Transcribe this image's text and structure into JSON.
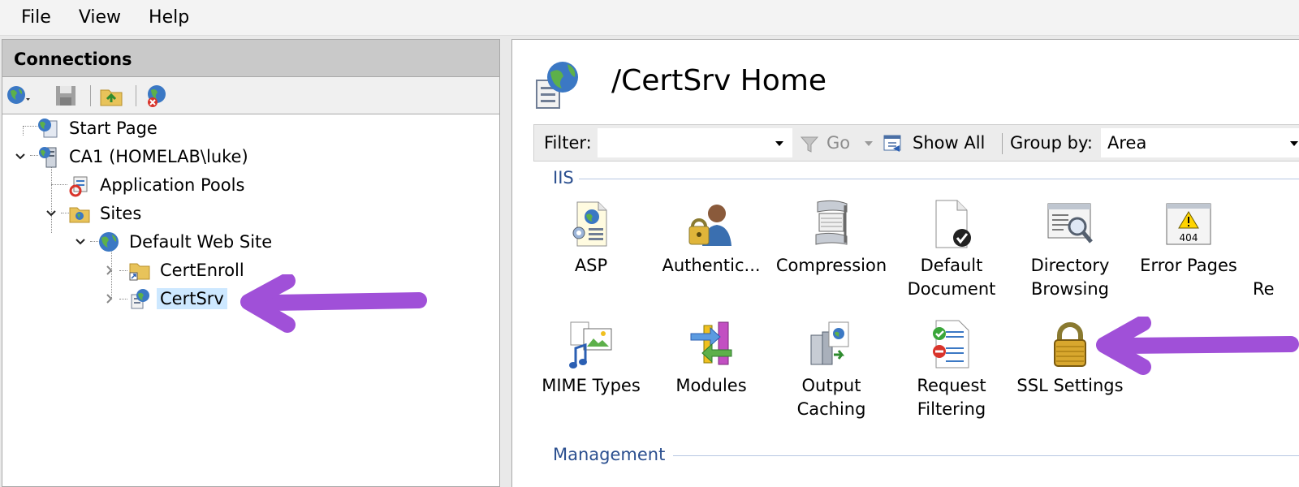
{
  "menu": {
    "file": "File",
    "view": "View",
    "help": "Help"
  },
  "connections": {
    "header": "Connections",
    "tree": [
      {
        "label": "Start Page"
      },
      {
        "label": "CA1 (HOMELAB\\luke)"
      },
      {
        "label": "Application Pools"
      },
      {
        "label": "Sites"
      },
      {
        "label": "Default Web Site"
      },
      {
        "label": "CertEnroll"
      },
      {
        "label": "CertSrv",
        "selected": true
      }
    ]
  },
  "main": {
    "title": "/CertSrv Home",
    "filter": {
      "label": "Filter:",
      "go": "Go",
      "show_all": "Show All",
      "group_by_label": "Group by:",
      "group_by_value": "Area"
    },
    "sections": [
      {
        "name": "IIS",
        "features": [
          {
            "label": "ASP",
            "icon": "asp-icon"
          },
          {
            "label": "Authentic...",
            "icon": "authentication-icon"
          },
          {
            "label": "Compression",
            "icon": "compression-icon"
          },
          {
            "label": "Default\nDocument",
            "icon": "default-document-icon"
          },
          {
            "label": "Directory\nBrowsing",
            "icon": "directory-browsing-icon"
          },
          {
            "label": "Error Pages",
            "icon": "error-pages-icon"
          },
          {
            "label": "Re",
            "icon": "cut-off-icon"
          },
          {
            "label": "MIME Types",
            "icon": "mime-types-icon"
          },
          {
            "label": "Modules",
            "icon": "modules-icon"
          },
          {
            "label": "Output\nCaching",
            "icon": "output-caching-icon"
          },
          {
            "label": "Request\nFiltering",
            "icon": "request-filtering-icon"
          },
          {
            "label": "SSL Settings",
            "icon": "ssl-settings-icon"
          }
        ]
      },
      {
        "name": "Management"
      }
    ]
  },
  "colors": {
    "annotation_arrow": "#a050d8",
    "selection": "#cde8ff",
    "section_text": "#2b4f8f"
  }
}
